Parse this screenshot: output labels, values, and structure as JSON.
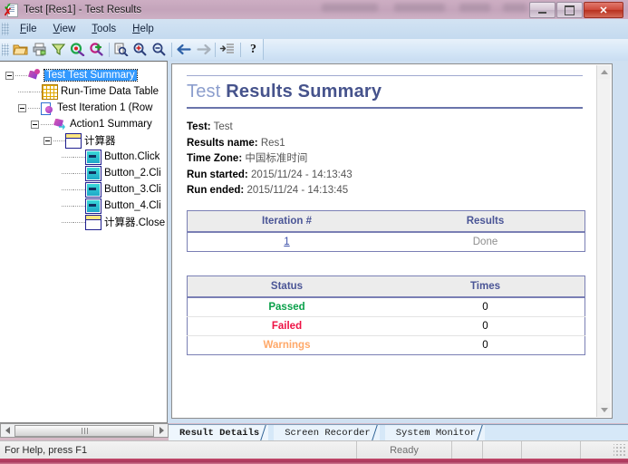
{
  "window": {
    "title": "Test [Res1] - Test Results",
    "icon": "test-results-icon",
    "minimize_label": "",
    "maximize_label": "",
    "close_label": "✕"
  },
  "menu": {
    "items": [
      {
        "label": "File",
        "accel": "F"
      },
      {
        "label": "View",
        "accel": "V"
      },
      {
        "label": "Tools",
        "accel": "T"
      },
      {
        "label": "Help",
        "accel": "H"
      }
    ]
  },
  "toolbar": {
    "buttons": [
      {
        "name": "open-folder-icon",
        "tip": "Open"
      },
      {
        "name": "print-icon",
        "tip": "Print"
      },
      {
        "name": "filter-icon",
        "tip": "Filter"
      },
      {
        "name": "find-next-result-icon",
        "tip": "Next Result"
      },
      {
        "name": "add-defect-icon",
        "tip": "Add Defect"
      },
      {
        "name": "find-text-icon",
        "tip": "Find"
      },
      {
        "name": "zoom-in-icon",
        "tip": "Zoom In"
      },
      {
        "name": "zoom-out-icon",
        "tip": "Zoom Out"
      },
      {
        "name": "back-arrow-icon",
        "tip": "Back"
      },
      {
        "name": "forward-arrow-icon",
        "tip": "Forward"
      },
      {
        "name": "collapse-tree-icon",
        "tip": "Collapse"
      },
      {
        "name": "help-icon",
        "tip": "Help"
      }
    ]
  },
  "tree": {
    "nodes": [
      {
        "label": "Test Test Summary",
        "icon": "summary-icon",
        "depth": 0,
        "expander": "minus",
        "selected": true
      },
      {
        "label": "Run-Time Data Table",
        "icon": "grid-icon",
        "depth": 1,
        "expander": "none",
        "selected": false
      },
      {
        "label": "Test Iteration 1 (Row",
        "icon": "iteration-icon",
        "depth": 1,
        "expander": "minus",
        "selected": false
      },
      {
        "label": "Action1 Summary",
        "icon": "action-icon",
        "depth": 2,
        "expander": "minus",
        "selected": false
      },
      {
        "label": "计算器",
        "icon": "window-icon",
        "depth": 3,
        "expander": "minus",
        "selected": false
      },
      {
        "label": "Button.Click",
        "icon": "button-icon",
        "depth": 4,
        "expander": "none",
        "selected": false
      },
      {
        "label": "Button_2.Cli",
        "icon": "button-icon",
        "depth": 4,
        "expander": "none",
        "selected": false
      },
      {
        "label": "Button_3.Cli",
        "icon": "button-icon",
        "depth": 4,
        "expander": "none",
        "selected": false
      },
      {
        "label": "Button_4.Cli",
        "icon": "button-icon",
        "depth": 4,
        "expander": "none",
        "selected": false
      },
      {
        "label": "计算器.Close",
        "icon": "window-icon",
        "depth": 4,
        "expander": "none",
        "selected": false
      }
    ]
  },
  "report": {
    "title_light": "Test",
    "title_dark": "Results Summary",
    "meta": [
      {
        "label": "Test",
        "value": "Test"
      },
      {
        "label": "Results name",
        "value": "Res1"
      },
      {
        "label": "Time Zone",
        "value": "中国标准时间"
      },
      {
        "label": "Run started",
        "value": "2015/11/24 - 14:13:43"
      },
      {
        "label": "Run ended",
        "value": "2015/11/24 - 14:13:45"
      }
    ],
    "iteration_table": {
      "headers": [
        "Iteration #",
        "Results"
      ],
      "rows": [
        {
          "iteration": "1",
          "result": "Done"
        }
      ]
    },
    "status_table": {
      "headers": [
        "Status",
        "Times"
      ],
      "rows": [
        {
          "status": "Passed",
          "times": "0",
          "color": "#0aa04a"
        },
        {
          "status": "Failed",
          "times": "0",
          "color": "#ee1144"
        },
        {
          "status": "Warnings",
          "times": "0",
          "color": "#ffa868"
        }
      ]
    }
  },
  "tabs": [
    {
      "label": "Result Details",
      "active": true
    },
    {
      "label": "Screen Recorder",
      "active": false
    },
    {
      "label": "System Monitor",
      "active": false
    }
  ],
  "statusbar": {
    "help_text": "For Help, press F1",
    "ready_text": "Ready",
    "cells": [
      "",
      "",
      "",
      ""
    ]
  },
  "colors": {
    "accent_blue": "#46538c",
    "title_light": "#8c9ecd",
    "selection": "#3399ff",
    "pass": "#0aa04a",
    "fail": "#ee1144",
    "warn": "#ffa868",
    "table_border": "#7a7fb4"
  }
}
